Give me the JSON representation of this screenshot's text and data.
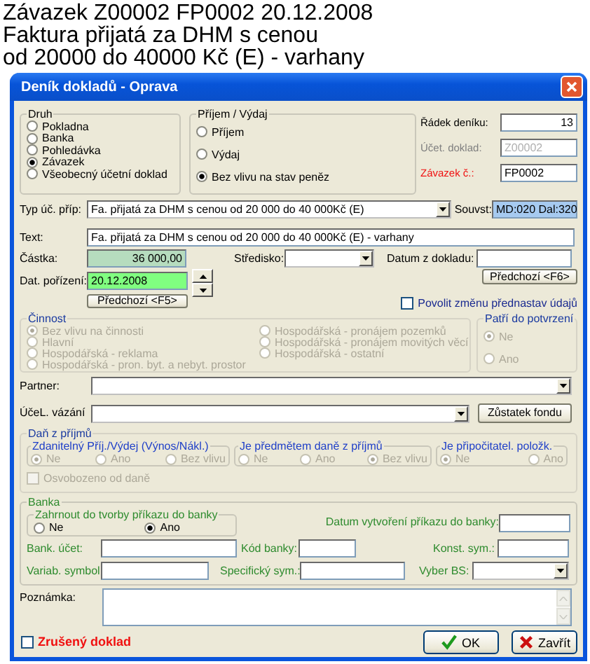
{
  "heading": [
    "Závazek Z00002 FP0002 20.12.2008",
    "Faktura přijatá za DHM s cenou",
    "od 20000 do 40000 Kč (E) - varhany"
  ],
  "window": {
    "title": "Deník dokladů - Oprava"
  },
  "druh": {
    "legend": "Druh",
    "options": [
      {
        "label": "Pokladna",
        "selected": false
      },
      {
        "label": "Banka",
        "selected": false
      },
      {
        "label": "Pohledávka",
        "selected": false
      },
      {
        "label": "Závazek",
        "selected": true
      },
      {
        "label": "Všeobecný účetní doklad",
        "selected": false
      }
    ]
  },
  "pohyb": {
    "legend": "Příjem / Výdaj",
    "options": [
      {
        "label": "Příjem",
        "selected": false
      },
      {
        "label": "Výdaj",
        "selected": false
      },
      {
        "label": "Bez vlivu na stav peněz",
        "selected": true
      }
    ]
  },
  "radek": {
    "label": "Řádek deníku:",
    "value": "13"
  },
  "ucet_doklad": {
    "label": "Účet. doklad:",
    "value": "Z00002",
    "disabled": true
  },
  "zavazek": {
    "label": "Závazek č.:",
    "value": "FP0002",
    "required": true
  },
  "typ": {
    "label": "Typ úč. příp:",
    "value": "Fa. přijatá za DHM s cenou od 20 000 do 40 000Kč (E)"
  },
  "souvst": {
    "label": "Souvst:",
    "value": "MD:020 Dal:320"
  },
  "text": {
    "label": "Text:",
    "value": "Fa. přijatá za DHM s cenou od 20 000 do 40 000Kč (E) - varhany"
  },
  "castka": {
    "label": "Částka:",
    "value": "36 000,00"
  },
  "stredisko": {
    "label": "Středisko:"
  },
  "datum_z_dokladu": {
    "label": "Datum z dokladu:"
  },
  "predchozi_f6": "Předchozí <F6>",
  "dat_porizeni": {
    "label": "Dat. pořízení:",
    "value": "20.12.2008"
  },
  "predchozi_f5": "Předchozí <F5>",
  "povolit": {
    "label": "Povolit změnu přednastav údajů",
    "checked": false
  },
  "cinnost": {
    "legend": "Činnost",
    "disabled": true,
    "options": [
      {
        "label": "Bez vlivu na činnosti",
        "selected": true
      },
      {
        "label": "Hlavní",
        "selected": false
      },
      {
        "label": "Hospodářská - reklama",
        "selected": false
      },
      {
        "label": "Hospodářská - pron. byt. a nebyt. prostor",
        "selected": false
      },
      {
        "label": "Hospodářská - pronájem pozemků",
        "selected": false
      },
      {
        "label": "Hospodářská - pronájem movitých věcí",
        "selected": false
      },
      {
        "label": "Hospodářská - ostatní",
        "selected": false
      }
    ]
  },
  "patri": {
    "legend": "Patří do potvrzení",
    "disabled": true,
    "options": [
      {
        "label": "Ne",
        "selected": true
      },
      {
        "label": "Ano",
        "selected": false
      }
    ]
  },
  "partner": {
    "label": "Partner:"
  },
  "ucel": {
    "label": "ÚčeL. vázání"
  },
  "zustatek": "Zůstatek fondu",
  "dan": {
    "legend": "Daň z příjmů",
    "disabled": true,
    "groups": [
      {
        "legend": "Zdanitelný Příj./Výdej (Výnos/Nákl.)",
        "options": [
          {
            "label": "Ne",
            "selected": true
          },
          {
            "label": "Ano",
            "selected": false
          },
          {
            "label": "Bez vlivu",
            "selected": false
          }
        ]
      },
      {
        "legend": "Je předmětem daně z příjmů",
        "options": [
          {
            "label": "Ne",
            "selected": false
          },
          {
            "label": "Ano",
            "selected": false
          },
          {
            "label": "Bez vlivu",
            "selected": true
          }
        ]
      },
      {
        "legend": "Je připočitatel. položk.",
        "options": [
          {
            "label": "Ne",
            "selected": true
          },
          {
            "label": "Ano",
            "selected": false
          }
        ]
      }
    ],
    "osvobozeno": {
      "label": "Osvobozeno od daně",
      "checked": false
    }
  },
  "banka": {
    "legend": "Banka",
    "zahrnout": {
      "legend": "Zahrnout do tvorby příkazu do banky",
      "options": [
        {
          "label": "Ne",
          "selected": false
        },
        {
          "label": "Ano",
          "selected": true
        }
      ]
    },
    "datum": {
      "label": "Datum vytvoření příkazu do banky:"
    },
    "bank_ucet": {
      "label": "Bank. účet:"
    },
    "kod_banky": {
      "label": "Kód banky:"
    },
    "konst_sym": {
      "label": "Konst. sym.:"
    },
    "variab_symbol": {
      "label": "Variab. symbol"
    },
    "specificky_sym": {
      "label": "Specifický sym.:"
    },
    "vyber_bs": {
      "label": "Vyber BS:"
    }
  },
  "poznamka": {
    "label": "Poznámka:"
  },
  "zruseny": {
    "label": "Zrušený doklad",
    "checked": false
  },
  "buttons": [
    {
      "label": "OK",
      "kind": "ok"
    },
    {
      "label": "Zavřít",
      "kind": "close"
    }
  ]
}
